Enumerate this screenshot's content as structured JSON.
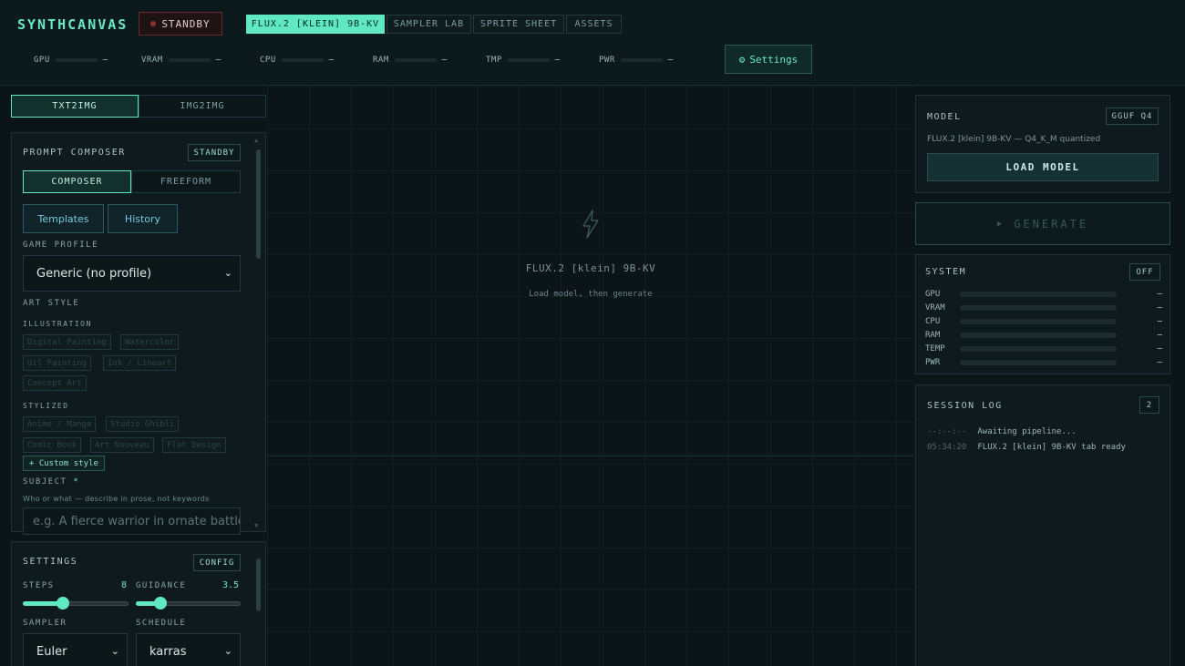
{
  "app": {
    "brand": "SYNTHCANVAS",
    "status": "STANDBY",
    "accent": "#5fe8c1"
  },
  "header": {
    "tabs": [
      {
        "label": "FLUX.2 [KLEIN] 9B-KV",
        "active": true
      },
      {
        "label": "SAMPLER LAB",
        "active": false
      },
      {
        "label": "SPRITE SHEET",
        "active": false
      },
      {
        "label": "ASSETS",
        "active": false
      }
    ],
    "stats": [
      {
        "label": "GPU",
        "value": "–"
      },
      {
        "label": "VRAM",
        "value": "–"
      },
      {
        "label": "CPU",
        "value": "–"
      },
      {
        "label": "RAM",
        "value": "–"
      },
      {
        "label": "TMP",
        "value": "–"
      },
      {
        "label": "PWR",
        "value": "–"
      }
    ],
    "settings_label": "Settings",
    "settings_icon": "gear-icon"
  },
  "mode_tabs": [
    {
      "label": "TXT2IMG",
      "active": true
    },
    {
      "label": "IMG2IMG",
      "active": false
    }
  ],
  "composer": {
    "title": "PROMPT COMPOSER",
    "badge": "STANDBY",
    "modes": [
      {
        "label": "COMPOSER",
        "active": true
      },
      {
        "label": "FREEFORM",
        "active": false
      }
    ],
    "templates_label": "Templates",
    "history_label": "History",
    "game_profile_label": "GAME PROFILE",
    "game_profile_value": "Generic (no profile)",
    "art_style_label": "ART STYLE",
    "illustration_label": "ILLUSTRATION",
    "illustration_chips": [
      "Digital Painting",
      "Watercolor",
      "Oil Painting",
      "Ink / Lineart",
      "Concept Art"
    ],
    "stylized_label": "STYLIZED",
    "stylized_chips": [
      "Anime / Manga",
      "Studio Ghibli",
      "Comic Book",
      "Art Nouveau",
      "Flat Design"
    ],
    "custom_style_label": "+ Custom style",
    "subject_label": "SUBJECT",
    "subject_required": "*",
    "subject_hint": "Who or what — describe in prose, not keywords",
    "subject_placeholder": "e.g. A fierce warrior in ornate battle"
  },
  "settings": {
    "title": "SETTINGS",
    "badge": "CONFIG",
    "steps_label": "STEPS",
    "steps_value": "8",
    "steps_fraction": 0.36,
    "guidance_label": "GUIDANCE",
    "guidance_value": "3.5",
    "guidance_fraction": 0.2,
    "sampler_label": "SAMPLER",
    "sampler_value": "Euler",
    "schedule_label": "SCHEDULE",
    "schedule_value": "karras"
  },
  "canvas": {
    "icon": "lightning-icon",
    "title": "FLUX.2 [klein] 9B-KV",
    "subtitle": "Load model, then generate"
  },
  "model": {
    "title": "MODEL",
    "badge": "GGUF Q4",
    "description": "FLUX.2 [klein] 9B-KV — Q4_K_M quantized",
    "load_label": "LOAD MODEL"
  },
  "generate": {
    "label": "GENERATE",
    "icon": "play-icon"
  },
  "system": {
    "title": "SYSTEM",
    "badge": "OFF",
    "rows": [
      {
        "label": "GPU",
        "value": "–"
      },
      {
        "label": "VRAM",
        "value": "–"
      },
      {
        "label": "CPU",
        "value": "–"
      },
      {
        "label": "RAM",
        "value": "–"
      },
      {
        "label": "TEMP",
        "value": "–"
      },
      {
        "label": "PWR",
        "value": "–"
      }
    ]
  },
  "session_log": {
    "title": "SESSION LOG",
    "count": "2",
    "entries": [
      {
        "time": "--:--:--",
        "message": "Awaiting pipeline..."
      },
      {
        "time": "05:34:20",
        "message": "FLUX.2 [klein] 9B-KV tab ready"
      }
    ]
  }
}
